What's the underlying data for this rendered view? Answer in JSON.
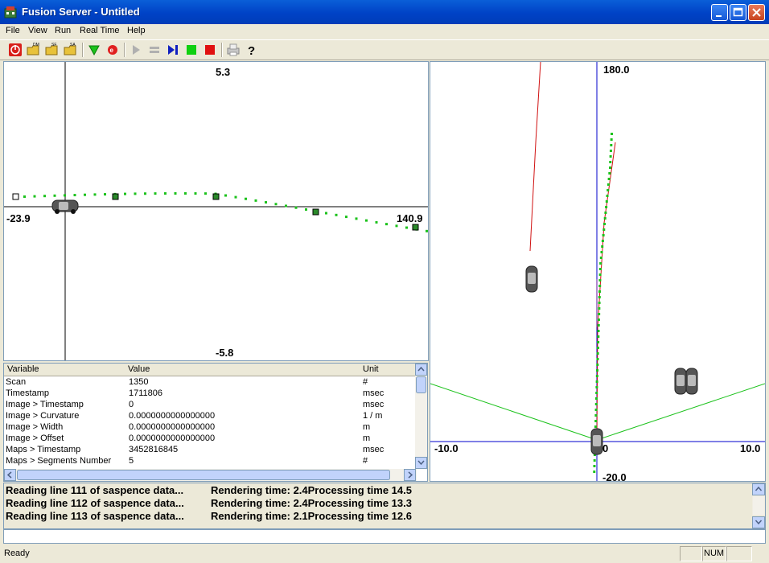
{
  "window": {
    "title": "Fusion Server - Untitled"
  },
  "menu": {
    "items": [
      "File",
      "View",
      "Run",
      "Real Time",
      "Help"
    ]
  },
  "toolbar": {
    "icons": [
      "power-icon",
      "open-dm-icon",
      "open-sf-icon",
      "open-sa-icon",
      "green-down-arrow-icon",
      "red-stop-circle-icon",
      "play-icon",
      "pause-icon",
      "step-icon",
      "green-square-icon",
      "red-square-icon",
      "print-icon",
      "help-icon"
    ]
  },
  "top_view": {
    "top_value": "5.3",
    "bottom_value": "-5.8",
    "left_value": "-23.9",
    "right_value": "140.9"
  },
  "bird_view": {
    "top_value": "180.0",
    "left_value": "-10.0",
    "center_value": "0",
    "right_value": "10.0",
    "bottom_value": "-20.0"
  },
  "variables": {
    "headers": [
      "Variable",
      "Value",
      "Unit"
    ],
    "rows": [
      [
        "Scan",
        "1350",
        "#"
      ],
      [
        "Timestamp",
        "1711806",
        "msec"
      ],
      [
        "Image > Timestamp",
        "0",
        "msec"
      ],
      [
        "Image > Curvature",
        "0.0000000000000000",
        "1 / m"
      ],
      [
        "Image > Width",
        "0.0000000000000000",
        "m"
      ],
      [
        "Image > Offset",
        "0.0000000000000000",
        "m"
      ],
      [
        "Maps > Timestamp",
        "3452816845",
        "msec"
      ],
      [
        "Maps > Segments Number",
        "5",
        "#"
      ]
    ]
  },
  "log": {
    "lines": [
      [
        "Reading line 111 of saspence data...",
        "Rendering time: 2.4Processing time 14.5"
      ],
      [
        "Reading line 112 of saspence data...",
        "Rendering time: 2.4Processing time 13.3"
      ],
      [
        "Reading line 113 of saspence data...",
        "Rendering time: 2.1Processing time 12.6"
      ]
    ]
  },
  "status": {
    "text": "Ready",
    "num": "NUM"
  }
}
